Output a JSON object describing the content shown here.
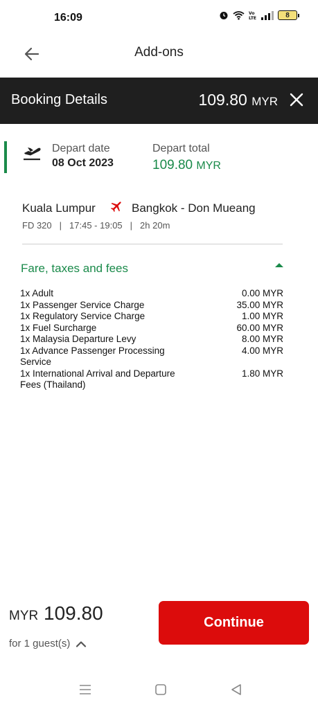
{
  "status_bar": {
    "time": "16:09",
    "icons": [
      "alarm-icon",
      "wifi-icon",
      "volte-icon",
      "signal-icon"
    ],
    "battery": "8"
  },
  "header": {
    "title": "Add-ons",
    "back_icon": "back-arrow-icon"
  },
  "booking_bar": {
    "title": "Booking Details",
    "amount": "109.80",
    "currency": "MYR",
    "close_icon": "close-icon"
  },
  "depart": {
    "date_label": "Depart date",
    "date_value": "08 Oct 2023",
    "total_label": "Depart total",
    "total_amount": "109.80",
    "total_currency": "MYR"
  },
  "flight": {
    "from": "Kuala Lumpur",
    "to": "Bangkok - Don Mueang",
    "flight_no": "FD 320",
    "times": "17:45 - 19:05",
    "duration": "2h 20m"
  },
  "fare": {
    "title": "Fare, taxes and fees",
    "items": [
      {
        "name": "1x Adult",
        "amount": "0.00 MYR"
      },
      {
        "name": "1x Passenger Service Charge",
        "amount": "35.00 MYR"
      },
      {
        "name": "1x Regulatory Service Charge",
        "amount": "1.00 MYR"
      },
      {
        "name": "1x Fuel Surcharge",
        "amount": "60.00 MYR"
      },
      {
        "name": "1x Malaysia Departure Levy",
        "amount": "8.00 MYR"
      },
      {
        "name": "1x Advance Passenger Processing Service",
        "amount": "4.00 MYR"
      },
      {
        "name": "1x International Arrival and Departure Fees (Thailand)",
        "amount": "1.80 MYR"
      }
    ]
  },
  "footer": {
    "currency": "MYR",
    "total": "109.80",
    "guests": "for 1 guest(s)",
    "continue_label": "Continue"
  },
  "colors": {
    "accent_green": "#1a8a4a",
    "brand_red": "#dc0c0c",
    "dark_bar": "#1f1f1f"
  }
}
